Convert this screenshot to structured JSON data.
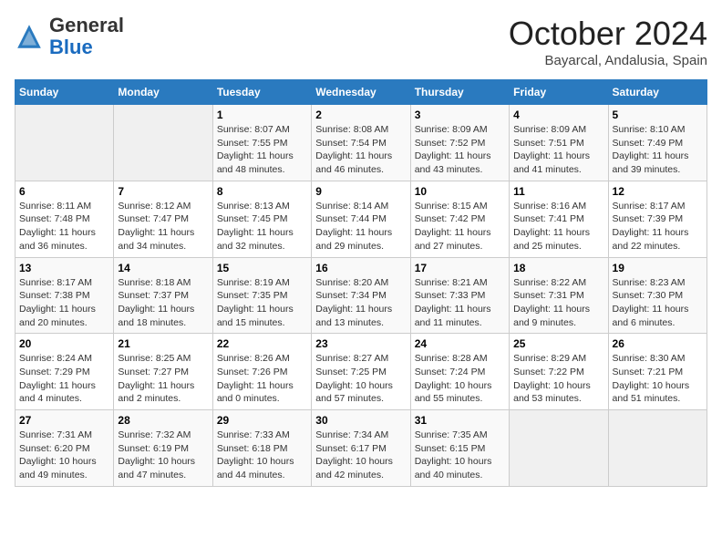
{
  "header": {
    "logo_general": "General",
    "logo_blue": "Blue",
    "month_title": "October 2024",
    "location": "Bayarcal, Andalusia, Spain"
  },
  "weekdays": [
    "Sunday",
    "Monday",
    "Tuesday",
    "Wednesday",
    "Thursday",
    "Friday",
    "Saturday"
  ],
  "weeks": [
    [
      {
        "day": "",
        "info": ""
      },
      {
        "day": "",
        "info": ""
      },
      {
        "day": "1",
        "info": "Sunrise: 8:07 AM\nSunset: 7:55 PM\nDaylight: 11 hours and 48 minutes."
      },
      {
        "day": "2",
        "info": "Sunrise: 8:08 AM\nSunset: 7:54 PM\nDaylight: 11 hours and 46 minutes."
      },
      {
        "day": "3",
        "info": "Sunrise: 8:09 AM\nSunset: 7:52 PM\nDaylight: 11 hours and 43 minutes."
      },
      {
        "day": "4",
        "info": "Sunrise: 8:09 AM\nSunset: 7:51 PM\nDaylight: 11 hours and 41 minutes."
      },
      {
        "day": "5",
        "info": "Sunrise: 8:10 AM\nSunset: 7:49 PM\nDaylight: 11 hours and 39 minutes."
      }
    ],
    [
      {
        "day": "6",
        "info": "Sunrise: 8:11 AM\nSunset: 7:48 PM\nDaylight: 11 hours and 36 minutes."
      },
      {
        "day": "7",
        "info": "Sunrise: 8:12 AM\nSunset: 7:47 PM\nDaylight: 11 hours and 34 minutes."
      },
      {
        "day": "8",
        "info": "Sunrise: 8:13 AM\nSunset: 7:45 PM\nDaylight: 11 hours and 32 minutes."
      },
      {
        "day": "9",
        "info": "Sunrise: 8:14 AM\nSunset: 7:44 PM\nDaylight: 11 hours and 29 minutes."
      },
      {
        "day": "10",
        "info": "Sunrise: 8:15 AM\nSunset: 7:42 PM\nDaylight: 11 hours and 27 minutes."
      },
      {
        "day": "11",
        "info": "Sunrise: 8:16 AM\nSunset: 7:41 PM\nDaylight: 11 hours and 25 minutes."
      },
      {
        "day": "12",
        "info": "Sunrise: 8:17 AM\nSunset: 7:39 PM\nDaylight: 11 hours and 22 minutes."
      }
    ],
    [
      {
        "day": "13",
        "info": "Sunrise: 8:17 AM\nSunset: 7:38 PM\nDaylight: 11 hours and 20 minutes."
      },
      {
        "day": "14",
        "info": "Sunrise: 8:18 AM\nSunset: 7:37 PM\nDaylight: 11 hours and 18 minutes."
      },
      {
        "day": "15",
        "info": "Sunrise: 8:19 AM\nSunset: 7:35 PM\nDaylight: 11 hours and 15 minutes."
      },
      {
        "day": "16",
        "info": "Sunrise: 8:20 AM\nSunset: 7:34 PM\nDaylight: 11 hours and 13 minutes."
      },
      {
        "day": "17",
        "info": "Sunrise: 8:21 AM\nSunset: 7:33 PM\nDaylight: 11 hours and 11 minutes."
      },
      {
        "day": "18",
        "info": "Sunrise: 8:22 AM\nSunset: 7:31 PM\nDaylight: 11 hours and 9 minutes."
      },
      {
        "day": "19",
        "info": "Sunrise: 8:23 AM\nSunset: 7:30 PM\nDaylight: 11 hours and 6 minutes."
      }
    ],
    [
      {
        "day": "20",
        "info": "Sunrise: 8:24 AM\nSunset: 7:29 PM\nDaylight: 11 hours and 4 minutes."
      },
      {
        "day": "21",
        "info": "Sunrise: 8:25 AM\nSunset: 7:27 PM\nDaylight: 11 hours and 2 minutes."
      },
      {
        "day": "22",
        "info": "Sunrise: 8:26 AM\nSunset: 7:26 PM\nDaylight: 11 hours and 0 minutes."
      },
      {
        "day": "23",
        "info": "Sunrise: 8:27 AM\nSunset: 7:25 PM\nDaylight: 10 hours and 57 minutes."
      },
      {
        "day": "24",
        "info": "Sunrise: 8:28 AM\nSunset: 7:24 PM\nDaylight: 10 hours and 55 minutes."
      },
      {
        "day": "25",
        "info": "Sunrise: 8:29 AM\nSunset: 7:22 PM\nDaylight: 10 hours and 53 minutes."
      },
      {
        "day": "26",
        "info": "Sunrise: 8:30 AM\nSunset: 7:21 PM\nDaylight: 10 hours and 51 minutes."
      }
    ],
    [
      {
        "day": "27",
        "info": "Sunrise: 7:31 AM\nSunset: 6:20 PM\nDaylight: 10 hours and 49 minutes."
      },
      {
        "day": "28",
        "info": "Sunrise: 7:32 AM\nSunset: 6:19 PM\nDaylight: 10 hours and 47 minutes."
      },
      {
        "day": "29",
        "info": "Sunrise: 7:33 AM\nSunset: 6:18 PM\nDaylight: 10 hours and 44 minutes."
      },
      {
        "day": "30",
        "info": "Sunrise: 7:34 AM\nSunset: 6:17 PM\nDaylight: 10 hours and 42 minutes."
      },
      {
        "day": "31",
        "info": "Sunrise: 7:35 AM\nSunset: 6:15 PM\nDaylight: 10 hours and 40 minutes."
      },
      {
        "day": "",
        "info": ""
      },
      {
        "day": "",
        "info": ""
      }
    ]
  ]
}
